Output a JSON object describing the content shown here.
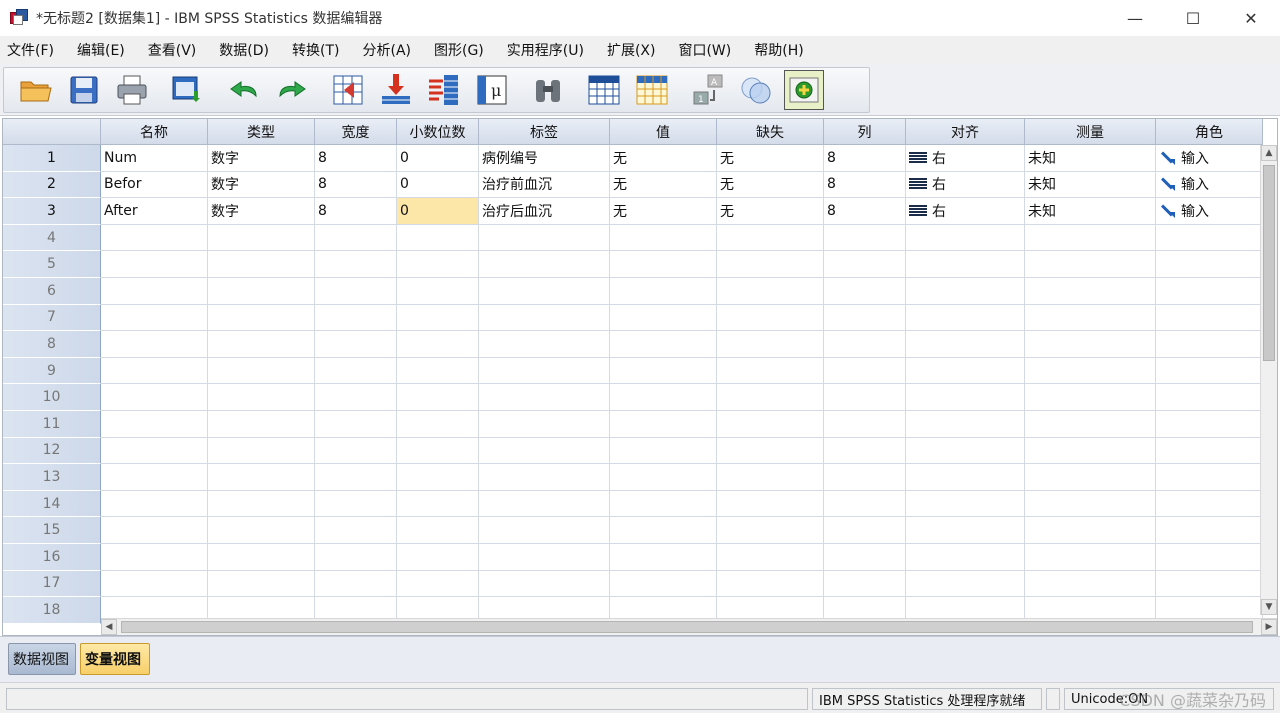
{
  "window": {
    "title": "*无标题2 [数据集1] - IBM SPSS Statistics 数据编辑器",
    "minimize": "—",
    "maximize": "☐",
    "close": "✕"
  },
  "menu": [
    "文件(F)",
    "编辑(E)",
    "查看(V)",
    "数据(D)",
    "转换(T)",
    "分析(A)",
    "图形(G)",
    "实用程序(U)",
    "扩展(X)",
    "窗口(W)",
    "帮助(H)"
  ],
  "toolbar": {
    "icons": [
      "open-icon",
      "save-icon",
      "print-icon",
      "dialog-recall-icon",
      "undo-icon",
      "redo-icon",
      "goto-case-icon",
      "goto-variable-icon",
      "variables-icon",
      "variable-info-icon",
      "find-icon",
      "insert-cases-icon",
      "insert-variable-icon",
      "split-file-icon",
      "weight-cases-icon",
      "value-labels-icon"
    ]
  },
  "grid": {
    "columns": [
      "名称",
      "类型",
      "宽度",
      "小数位数",
      "标签",
      "值",
      "缺失",
      "列",
      "对齐",
      "测量",
      "角色"
    ],
    "rows": [
      {
        "num": "1",
        "name": "Num",
        "type": "数字",
        "width": "8",
        "decimals": "0",
        "label": "病例编号",
        "values": "无",
        "missing": "无",
        "columns": "8",
        "align": "右",
        "measure": "未知",
        "role": "输入"
      },
      {
        "num": "2",
        "name": "Befor",
        "type": "数字",
        "width": "8",
        "decimals": "0",
        "label": "治疗前血沉",
        "values": "无",
        "missing": "无",
        "columns": "8",
        "align": "右",
        "measure": "未知",
        "role": "输入"
      },
      {
        "num": "3",
        "name": "After",
        "type": "数字",
        "width": "8",
        "decimals": "0",
        "label": "治疗后血沉",
        "values": "无",
        "missing": "无",
        "columns": "8",
        "align": "右",
        "measure": "未知",
        "role": "输入"
      }
    ],
    "empty_row_numbers": [
      "4",
      "5",
      "6",
      "7",
      "8",
      "9",
      "10",
      "11",
      "12",
      "13",
      "14",
      "15",
      "16",
      "17",
      "18"
    ],
    "selected_cell": "row 3, 小数位数",
    "selected_color": "#fde7a8"
  },
  "tabs": {
    "data_view": "数据视图",
    "variable_view": "变量视图",
    "active": "变量视图"
  },
  "status": {
    "processor": "IBM SPSS Statistics 处理程序就绪",
    "unicode": "Unicode:ON",
    "watermark": "CSDN @蔬菜杂乃码"
  }
}
